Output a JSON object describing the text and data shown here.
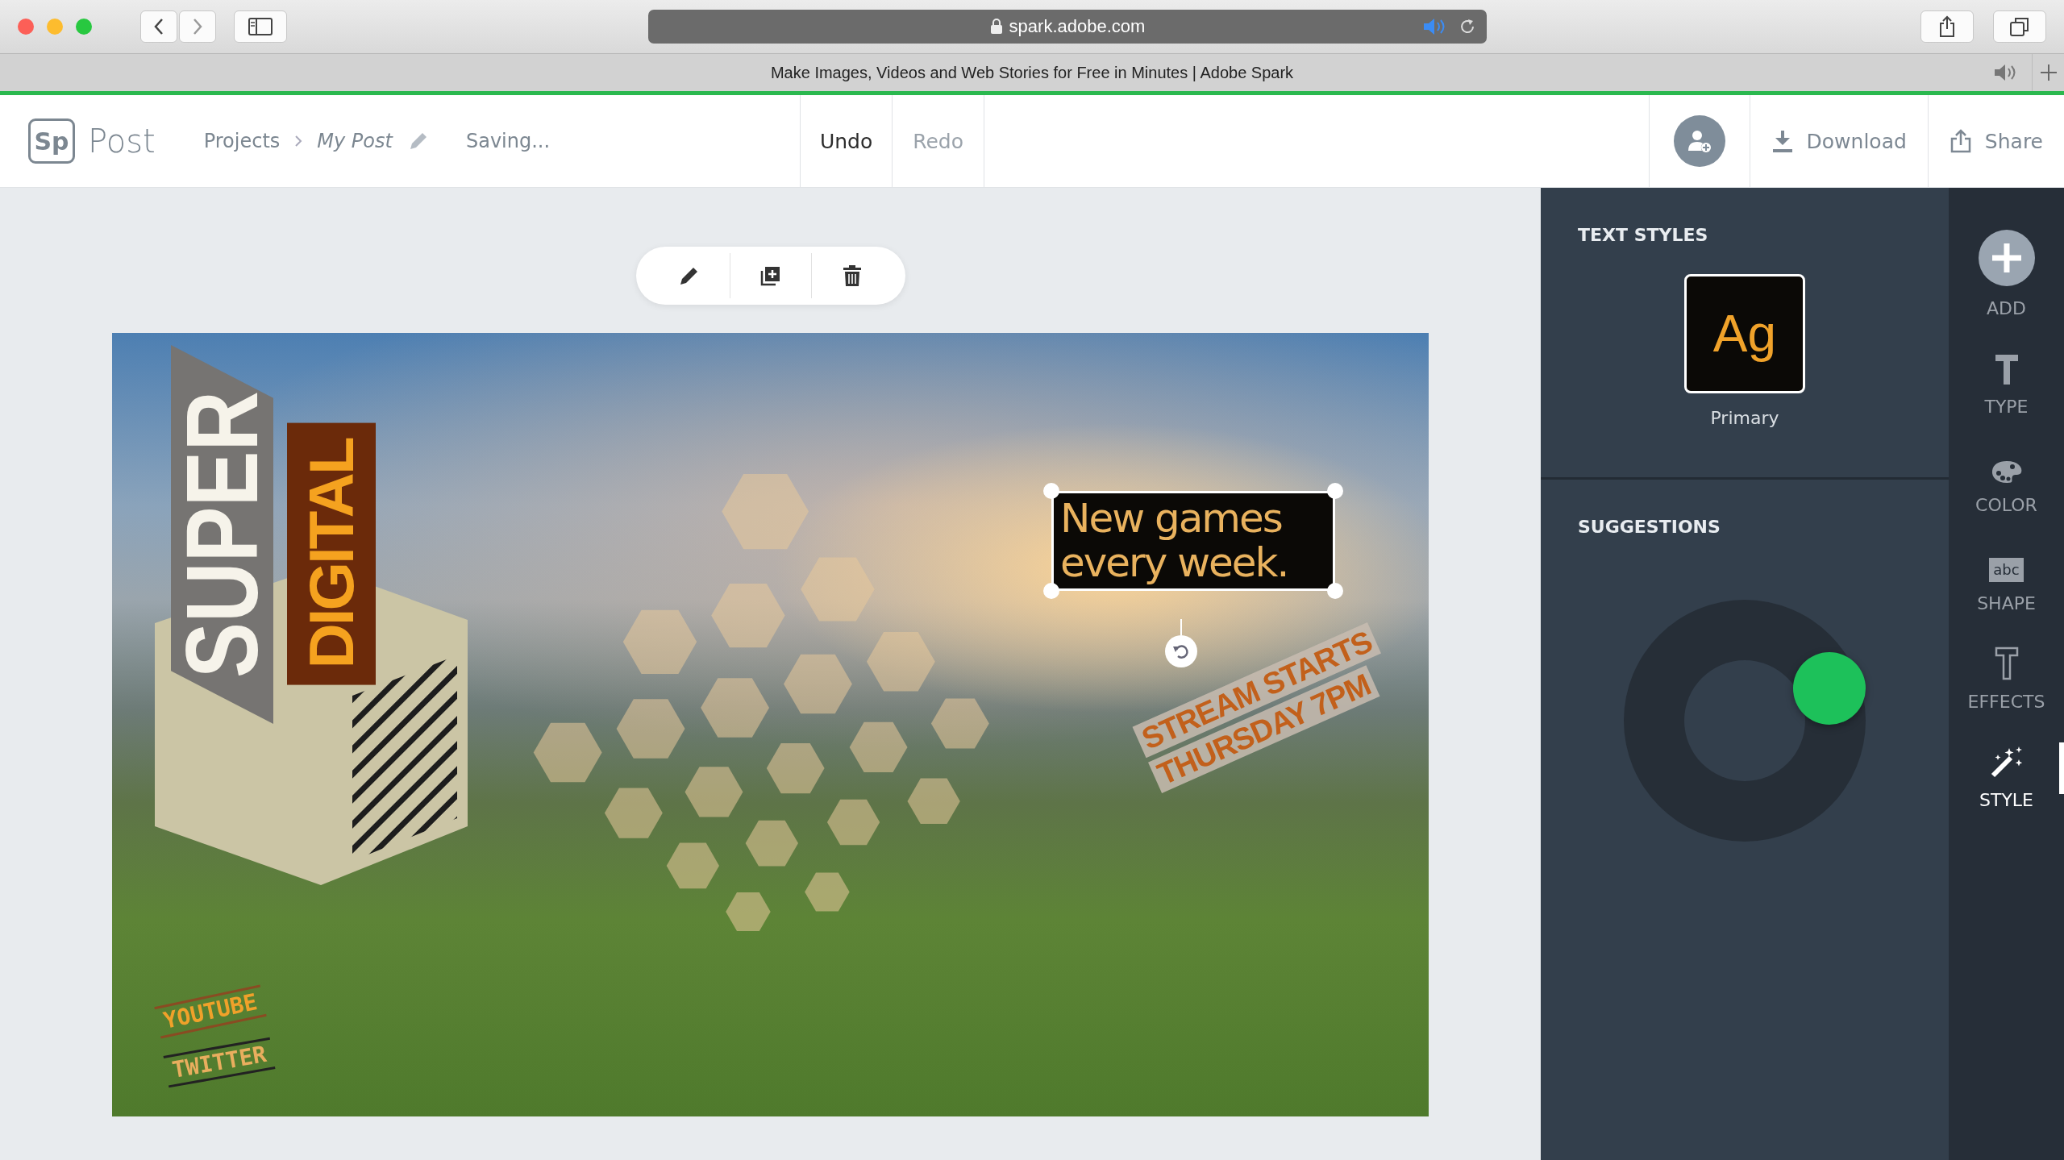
{
  "browser": {
    "url": "spark.adobe.com",
    "tab_title": "Make Images, Videos and Web Stories for Free in Minutes | Adobe Spark"
  },
  "app": {
    "logo": "Sp",
    "product": "Post"
  },
  "breadcrumb": {
    "parent": "Projects",
    "current": "My Post"
  },
  "save_status": "Saving...",
  "history": [
    {
      "label": "Undo",
      "disabled": false
    },
    {
      "label": "Redo",
      "disabled": true
    }
  ],
  "actions": [
    {
      "kind": "download",
      "label": "Download"
    },
    {
      "kind": "share",
      "label": "Share"
    }
  ],
  "canvas": {
    "vertical_title": "SUPER",
    "vertical_subtitle": "DIGITAL",
    "headline": {
      "text": "New games every week.",
      "selected": true
    },
    "tilted_caption": [
      "STREAM STARTS",
      "THURSDAY 7PM"
    ],
    "social_tags": [
      "YOUTUBE",
      "TWITTER"
    ]
  },
  "panel": {
    "text_styles": {
      "title": "TEXT STYLES",
      "items": [
        {
          "sample": "Ag",
          "name": "Primary",
          "selected": true
        }
      ]
    },
    "suggestions": {
      "title": "SUGGESTIONS"
    }
  },
  "rail": [
    {
      "kind": "add",
      "label": "ADD",
      "selected": false
    },
    {
      "kind": "type",
      "label": "TYPE",
      "selected": false
    },
    {
      "kind": "color",
      "label": "COLOR",
      "selected": false
    },
    {
      "kind": "shape",
      "label": "SHAPE",
      "icon_text": "abc",
      "selected": false
    },
    {
      "kind": "effects",
      "label": "EFFECTS",
      "selected": false
    },
    {
      "kind": "style",
      "label": "STYLE",
      "selected": true
    }
  ]
}
